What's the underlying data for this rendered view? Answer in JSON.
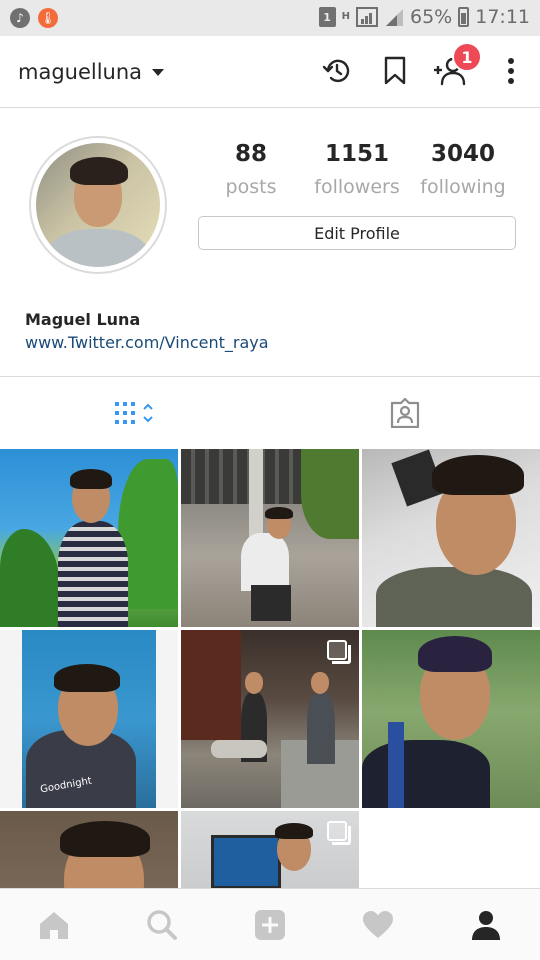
{
  "status_bar": {
    "battery_percent": "65%",
    "time": "17:11",
    "sim_label": "1",
    "network_type": "H",
    "icons": [
      "music-icon",
      "fire-icon",
      "sim-icon",
      "signal-icon",
      "battery-icon"
    ]
  },
  "top_bar": {
    "username": "maguelluna",
    "notification_count": "1",
    "icons": [
      "history-icon",
      "bookmark-icon",
      "add-person-icon",
      "more-icon"
    ]
  },
  "profile": {
    "stats": [
      {
        "value": "88",
        "label": "posts"
      },
      {
        "value": "1151",
        "label": "followers"
      },
      {
        "value": "3040",
        "label": "following"
      }
    ],
    "edit_button_label": "Edit Profile",
    "full_name": "Maguel Luna",
    "website": "www.Twitter.com/Vincent_raya"
  },
  "tabs": [
    {
      "name": "grid-view",
      "icon": "grid-icon",
      "active": true
    },
    {
      "name": "tagged-photos",
      "icon": "tagged-person-icon",
      "active": false
    }
  ],
  "posts": [
    {
      "text": "",
      "multi": false
    },
    {
      "text": "",
      "multi": false
    },
    {
      "text": "",
      "multi": false
    },
    {
      "text": "Goodnight",
      "multi": false
    },
    {
      "text": "",
      "multi": true
    },
    {
      "text": "",
      "multi": false
    },
    {
      "text": "",
      "multi": false
    },
    {
      "text": "",
      "multi": false
    },
    {
      "text": "",
      "multi": true
    },
    {
      "text": "",
      "multi": false
    }
  ],
  "bottom_nav": [
    "home-icon",
    "search-icon",
    "add-post-icon",
    "heart-icon",
    "profile-icon"
  ],
  "colors": {
    "accent_blue": "#3897f0",
    "badge_red": "#ed4956",
    "link_blue": "#1b4a78",
    "muted_gray": "#a8a8a8"
  }
}
